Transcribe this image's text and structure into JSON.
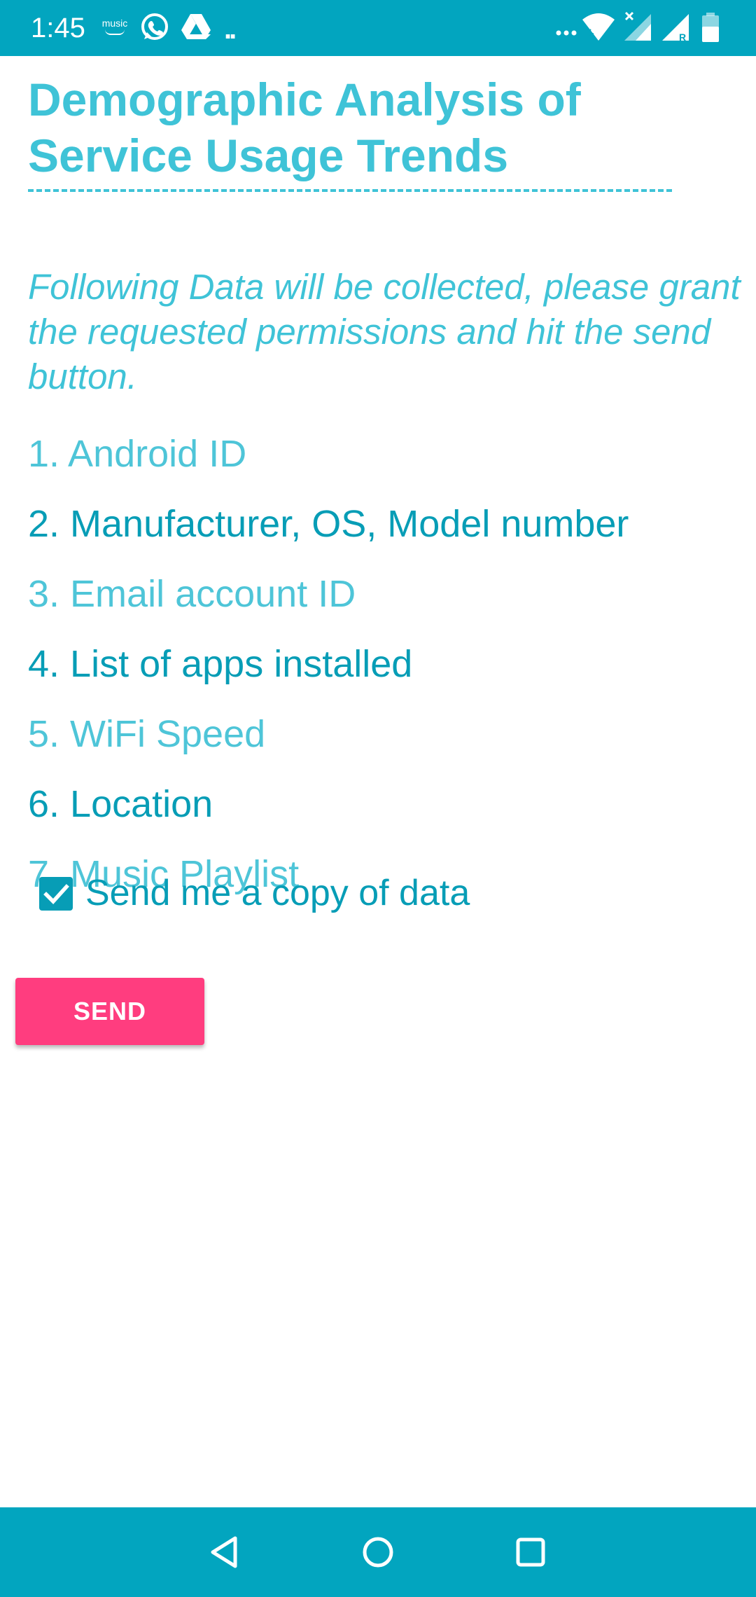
{
  "theme": {
    "status_bar_color": "#02a5bf",
    "accent_color": "#3fc3d7",
    "button_color": "#ff3d7f"
  },
  "status_bar": {
    "time": "1:45",
    "left_icons": [
      "amazon-music-icon",
      "whatsapp-icon",
      "google-drive-icon",
      "more-notifications-icon"
    ],
    "music_label": "music",
    "overflow_dots": "..",
    "right_icons": [
      "more-dots-icon",
      "wifi-icon",
      "signal-no-data-icon",
      "signal-roaming-icon",
      "battery-icon"
    ],
    "roaming_letter": "R"
  },
  "page": {
    "title": "Demographic Analysis of Service Usage Trends",
    "divider": "--------------------------------------",
    "intro": "Following Data will be collected, please grant the requested permissions and hit the send button.",
    "items": [
      "1. Android ID",
      "2. Manufacturer, OS, Model number",
      "3. Email account ID",
      "4. List of apps installed",
      "5. WiFi Speed",
      "6. Location",
      "7. Music Playlist"
    ],
    "copy_checkbox": {
      "label": "Send me a copy of data",
      "checked": true
    },
    "send_label": "SEND"
  },
  "nav_bar": {
    "buttons": [
      "back-icon",
      "home-icon",
      "recents-icon"
    ]
  }
}
